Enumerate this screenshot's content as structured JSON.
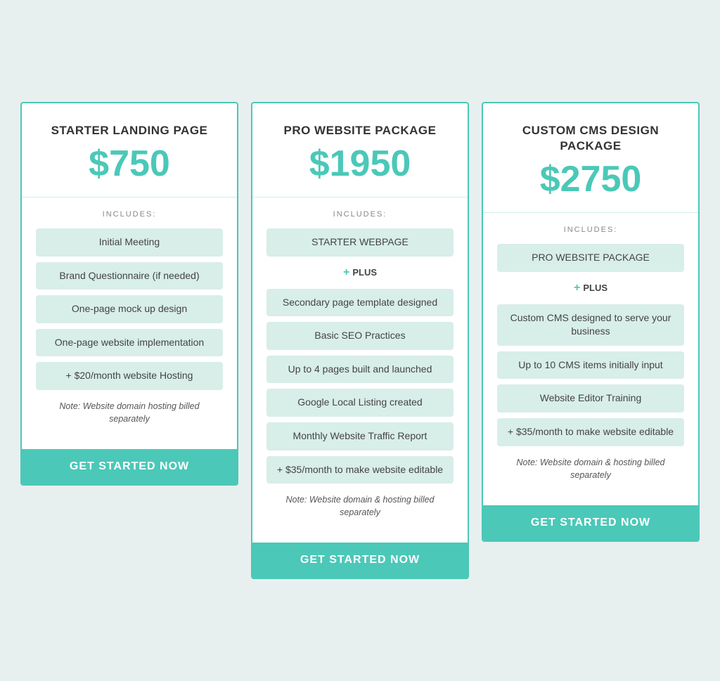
{
  "cards": [
    {
      "id": "starter",
      "title": "STARTER LANDING PAGE",
      "price": "$750",
      "includes_label": "INCLUDES:",
      "features": [
        {
          "text": "Initial Meeting",
          "type": "item"
        },
        {
          "text": "Brand Questionnaire (if needed)",
          "type": "item"
        },
        {
          "text": "One-page mock up design",
          "type": "item"
        },
        {
          "text": "One-page website implementation",
          "type": "item"
        },
        {
          "text": "+ $20/month website Hosting",
          "type": "item"
        }
      ],
      "note": "Note: Website domain hosting billed separately",
      "cta": "GET STARTED NOW"
    },
    {
      "id": "pro",
      "title": "PRO WEBSITE PACKAGE",
      "price": "$1950",
      "includes_label": "INCLUDES:",
      "features": [
        {
          "text": "STARTER WEBPAGE",
          "type": "item"
        },
        {
          "text": "+ PLUS",
          "type": "divider"
        },
        {
          "text": "Secondary page template designed",
          "type": "item"
        },
        {
          "text": "Basic SEO Practices",
          "type": "item"
        },
        {
          "text": "Up to 4 pages built and launched",
          "type": "item"
        },
        {
          "text": "Google Local Listing created",
          "type": "item"
        },
        {
          "text": "Monthly Website Traffic Report",
          "type": "item"
        },
        {
          "text": "+ $35/month to make website editable",
          "type": "item"
        }
      ],
      "note": "Note: Website domain & hosting billed separately",
      "cta": "GET STARTED NOW"
    },
    {
      "id": "custom",
      "title": "CUSTOM CMS DESIGN PACKAGE",
      "price": "$2750",
      "includes_label": "INCLUDES:",
      "features": [
        {
          "text": "PRO WEBSITE PACKAGE",
          "type": "item"
        },
        {
          "text": "+ PLUS",
          "type": "divider"
        },
        {
          "text": "Custom CMS designed to serve your business",
          "type": "item"
        },
        {
          "text": "Up to 10 CMS items initially input",
          "type": "item"
        },
        {
          "text": "Website Editor Training",
          "type": "item"
        },
        {
          "text": "+ $35/month to make website editable",
          "type": "item"
        }
      ],
      "note": "Note: Website domain & hosting billed separately",
      "cta": "GET STARTED NOW"
    }
  ]
}
